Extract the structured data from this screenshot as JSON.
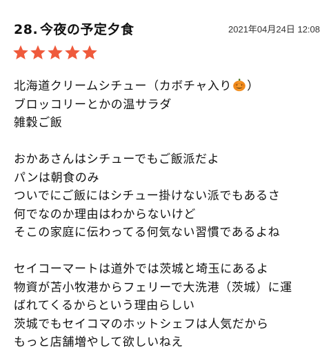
{
  "review": {
    "number": "28.",
    "title": "今夜の予定夕食",
    "timestamp": "2021年04月24日 12:08",
    "rating": 5,
    "star_color": "#ef5a3c",
    "body": {
      "line1_before_icon": "北海道クリームシチュー（カボチャ入り",
      "line1_icon": "pumpkin-icon",
      "line1_after_icon": "）",
      "line2": "ブロッコリーとかの温サラダ",
      "line3": "雑穀ご飯",
      "line4": "おかあさんはシチューでもご飯派だよ",
      "line5": "パンは朝食のみ",
      "line6": "ついでにご飯にはシチュー掛けない派でもあるさ",
      "line7": "何でなのか理由はわからないけど",
      "line8": "そこの家庭に伝わってる何気ない習慣であるよね",
      "line9": "セイコーマートは道外では茨城と埼玉にあるよ",
      "line10": "物資が苫小牧港からフェリーで大洗港（茨城）に運",
      "line11": "ばれてくるからという理由らしい",
      "line12": "茨城でもセイコマのホットシェフは人気だから",
      "line13": "もっと店舗増やして欲しいねえ"
    }
  }
}
